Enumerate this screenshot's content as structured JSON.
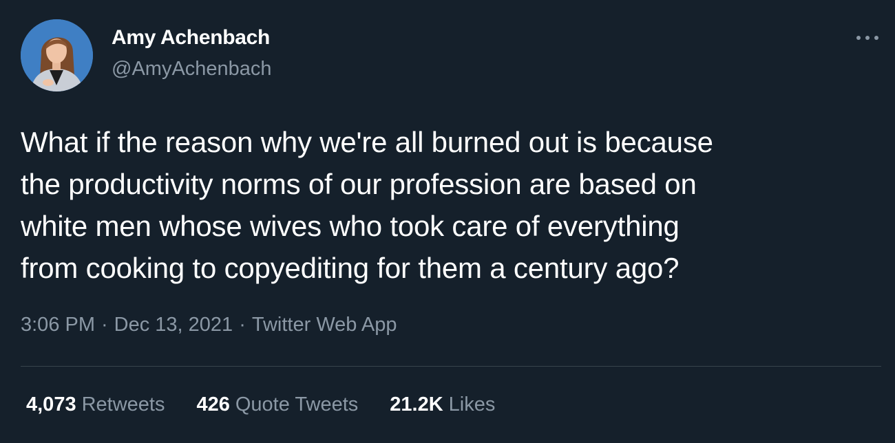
{
  "tweet": {
    "author": {
      "display_name": "Amy Achenbach",
      "handle": "@AmyAchenbach",
      "avatar_icon": "profile-photo"
    },
    "more_icon": "ellipsis-icon",
    "text_lines": [
      "What if the reason why we're all burned out is because",
      "the productivity norms of our profession are based on",
      "white men whose wives who took care of everything",
      "from cooking to copyediting for them a century ago?"
    ],
    "meta": {
      "time": "3:06 PM",
      "separator": "·",
      "date": "Dec 13, 2021",
      "source": "Twitter Web App"
    },
    "stats": {
      "retweets": {
        "count": "4,073",
        "label": "Retweets"
      },
      "quote_tweets": {
        "count": "426",
        "label": "Quote Tweets"
      },
      "likes": {
        "count": "21.2K",
        "label": "Likes"
      }
    },
    "colors": {
      "background": "#15202b",
      "primary_text": "#ffffff",
      "secondary_text": "#8b98a5",
      "divider": "#38444d"
    }
  }
}
